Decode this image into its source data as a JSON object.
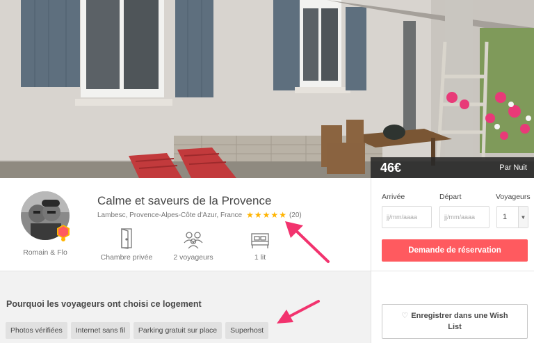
{
  "hero": {
    "price": "46€",
    "price_unit": "Par Nuit"
  },
  "listing": {
    "title": "Calme et saveurs de la Provence",
    "location": "Lambesc, Provence-Alpes-Côte d'Azur, France",
    "rating_stars": 5,
    "review_count": "(20)",
    "host_name": "Romain & Flo",
    "amenities": [
      {
        "label": "Chambre privée",
        "icon": "door-icon"
      },
      {
        "label": "2 voyageurs",
        "icon": "guests-icon"
      },
      {
        "label": "1 lit",
        "icon": "bed-icon"
      }
    ]
  },
  "booking": {
    "checkin_label": "Arrivée",
    "checkout_label": "Départ",
    "guests_label": "Voyageurs",
    "checkin_placeholder": "jj/mm/aaaa",
    "checkout_placeholder": "jj/mm/aaaa",
    "guests_value": "1",
    "book_button": "Demande de réservation"
  },
  "why": {
    "title": "Pourquoi les voyageurs ont choisi ce logement",
    "tags": [
      "Photos vérifiées",
      "Internet sans fil",
      "Parking gratuit sur place",
      "Superhost"
    ]
  },
  "wishlist": {
    "button": "Enregistrer dans une Wish List"
  },
  "colors": {
    "accent": "#ff5a5f",
    "star": "#ffb400",
    "annotation_arrow": "#f2336e"
  }
}
